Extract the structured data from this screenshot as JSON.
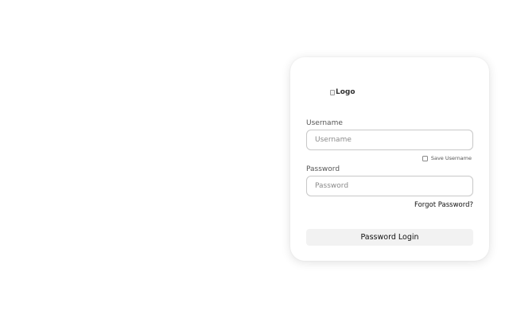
{
  "login": {
    "logo_alt": "Logo",
    "username_label": "Username",
    "username_placeholder": "Username",
    "username_value": "",
    "save_username_label": "Save Username",
    "save_username_checked": false,
    "password_label": "Password",
    "password_placeholder": "Password",
    "password_value": "",
    "forgot_password": "Forgot Password?",
    "login_button": "Password Login"
  }
}
